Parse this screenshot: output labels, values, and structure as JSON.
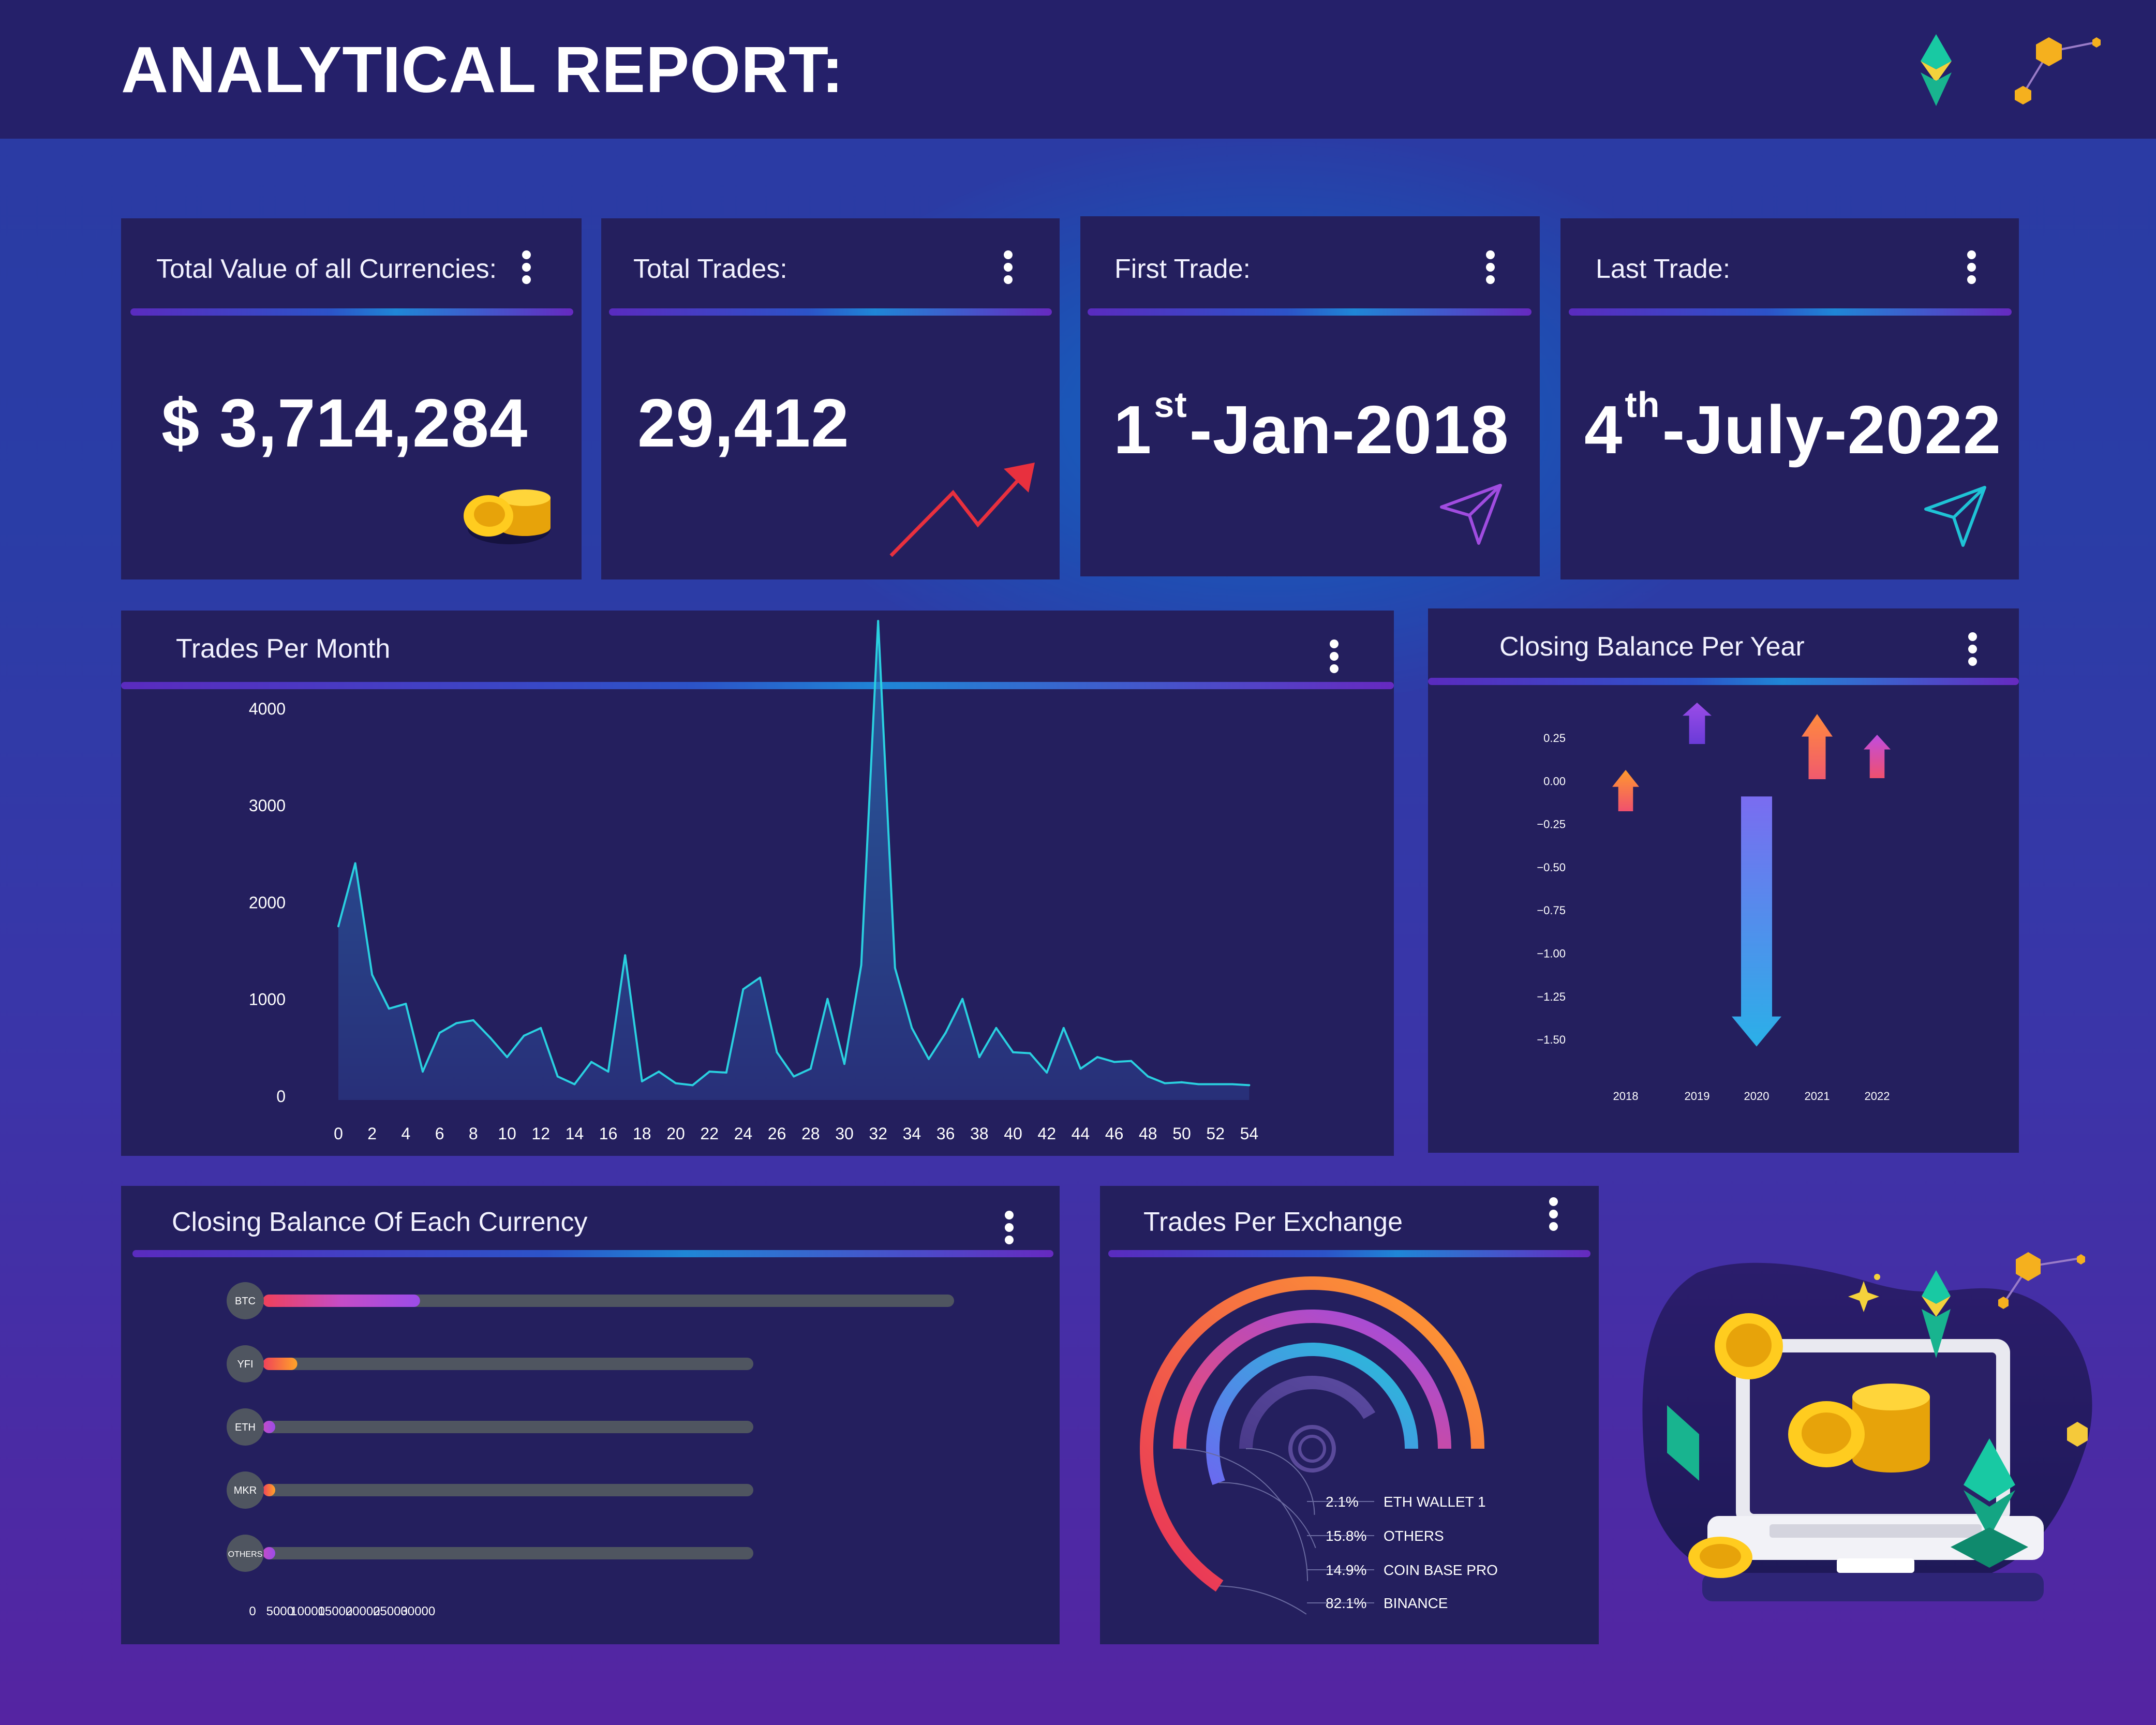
{
  "header": {
    "title": "ANALYTICAL REPORT:"
  },
  "kpis": [
    {
      "title": "Total  Value of all Currencies:",
      "value": "$ 3,714,284"
    },
    {
      "title": "Total Trades:",
      "value": "29,412"
    },
    {
      "title": "First Trade:",
      "value_day": "1",
      "value_suffix": "st",
      "value_rest": "-Jan-2018"
    },
    {
      "title": "Last Trade:",
      "value_day": "4",
      "value_suffix": "th",
      "value_rest": "-July-2022"
    }
  ],
  "panels": {
    "trades_per_month": "Trades Per Month",
    "closing_balance_per_year": "Closing Balance Per Year",
    "closing_balance_each_currency": "Closing Balance Of Each Currency",
    "trades_per_exchange": "Trades Per Exchange"
  },
  "colors": {
    "panel": "#241f5e",
    "header": "#25206a",
    "line": "#2ad0e0",
    "bar_track": "#4f5560",
    "accent_orange": "#ff8a3d",
    "accent_purple": "#9b4ce8"
  },
  "chart_data": [
    {
      "id": "trades_per_month",
      "type": "area",
      "title": "Trades Per Month",
      "xlim": [
        0,
        55
      ],
      "ylim": [
        0,
        4000
      ],
      "x_ticks": [
        0,
        2,
        4,
        6,
        8,
        10,
        12,
        14,
        16,
        18,
        20,
        22,
        24,
        26,
        28,
        30,
        32,
        34,
        36,
        38,
        40,
        42,
        44,
        46,
        48,
        50,
        52,
        54
      ],
      "y_ticks": [
        0,
        1000,
        2000,
        3000,
        4000
      ],
      "x": [
        0,
        1,
        2,
        3,
        4,
        5,
        6,
        7,
        8,
        9,
        10,
        11,
        12,
        13,
        14,
        15,
        16,
        17,
        18,
        19,
        20,
        21,
        22,
        23,
        24,
        25,
        26,
        27,
        28,
        29,
        30,
        31,
        32,
        33,
        34,
        35,
        36,
        37,
        38,
        39,
        40,
        41,
        42,
        43,
        44,
        45,
        46,
        47,
        48,
        49,
        50,
        51,
        52,
        53,
        54
      ],
      "values": [
        1750,
        2400,
        1250,
        900,
        950,
        250,
        650,
        750,
        780,
        600,
        400,
        620,
        700,
        200,
        120,
        350,
        250,
        1450,
        150,
        250,
        130,
        110,
        250,
        240,
        1100,
        1220,
        450,
        200,
        280,
        1000,
        330,
        1350,
        4900,
        1320,
        700,
        380,
        650,
        1000,
        400,
        700,
        450,
        440,
        240,
        700,
        280,
        400,
        350,
        360,
        200,
        130,
        140,
        120,
        120,
        120,
        110
      ]
    },
    {
      "id": "closing_balance_per_year",
      "type": "bar",
      "title": "Closing Balance Per Year",
      "categories": [
        "2018",
        "2019",
        "2020",
        "2021",
        "2022"
      ],
      "values": [
        -0.25,
        0.0,
        -1.55,
        0.0,
        0.0
      ],
      "ylim": [
        -1.55,
        0.25
      ],
      "y_ticks": [
        "0.25",
        "0.00",
        "−0.25",
        "−0.50",
        "−0.75",
        "−1.00",
        "−1.25",
        "−1.50"
      ]
    },
    {
      "id": "closing_balance_each_currency",
      "type": "bar",
      "orientation": "horizontal",
      "title": "Closing Balance Of Each Currency",
      "categories": [
        "BTC",
        "YFI",
        "ETH",
        "MKR",
        "OTHERS"
      ],
      "values": [
        28500,
        6250,
        1350,
        700,
        1850
      ],
      "xlim": [
        0,
        31000
      ],
      "x_ticks": [
        0,
        5000,
        10000,
        15000,
        20000,
        25000,
        30000
      ]
    },
    {
      "id": "trades_per_exchange",
      "type": "pie",
      "title": "Trades Per Exchange",
      "labels": [
        "ETH WALLET 1",
        "OTHERS",
        "COIN BASE PRO",
        "BINANCE"
      ],
      "percent_labels": [
        "2.1%",
        "15.8%",
        "14.9%",
        "82.1%"
      ],
      "values": [
        2.1,
        15.8,
        14.9,
        82.1
      ]
    }
  ]
}
